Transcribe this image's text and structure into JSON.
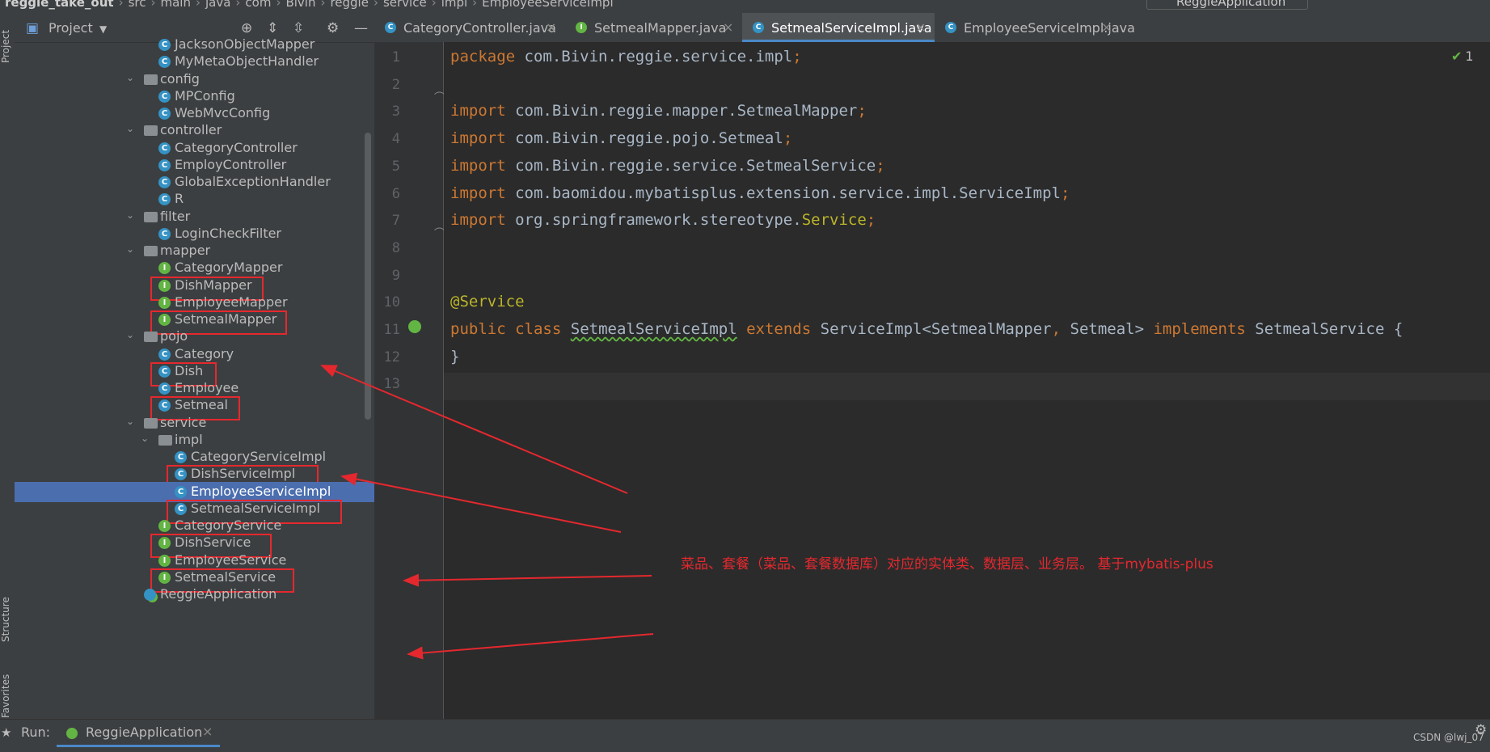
{
  "breadcrumb": {
    "items": [
      "reggie_take_out",
      "src",
      "main",
      "java",
      "com",
      "Bivin",
      "reggie",
      "service",
      "impl",
      "EmployeeServiceImpl"
    ],
    "run_config": "ReggieApplication"
  },
  "left_strip": {
    "tabs": [
      "Project",
      "Structure",
      "Favorites"
    ]
  },
  "project_panel": {
    "title": "Project",
    "tree": [
      {
        "label": "JacksonObjectMapper",
        "kind": "class",
        "level": 2
      },
      {
        "label": "MyMetaObjectHandler",
        "kind": "class",
        "level": 2
      },
      {
        "label": "config",
        "kind": "folder",
        "level": 1,
        "expanded": true
      },
      {
        "label": "MPConfig",
        "kind": "class",
        "level": 2
      },
      {
        "label": "WebMvcConfig",
        "kind": "class",
        "level": 2
      },
      {
        "label": "controller",
        "kind": "folder",
        "level": 1,
        "expanded": true
      },
      {
        "label": "CategoryController",
        "kind": "class",
        "level": 2
      },
      {
        "label": "EmployController",
        "kind": "class",
        "level": 2
      },
      {
        "label": "GlobalExceptionHandler",
        "kind": "class",
        "level": 2
      },
      {
        "label": "R",
        "kind": "class",
        "level": 2
      },
      {
        "label": "filter",
        "kind": "folder",
        "level": 1,
        "expanded": true
      },
      {
        "label": "LoginCheckFilter",
        "kind": "class",
        "level": 2
      },
      {
        "label": "mapper",
        "kind": "folder",
        "level": 1,
        "expanded": true
      },
      {
        "label": "CategoryMapper",
        "kind": "interface",
        "level": 2
      },
      {
        "label": "DishMapper",
        "kind": "interface",
        "level": 2,
        "highlighted": true
      },
      {
        "label": "EmployeeMapper",
        "kind": "interface",
        "level": 2
      },
      {
        "label": "SetmealMapper",
        "kind": "interface",
        "level": 2,
        "highlighted": true
      },
      {
        "label": "pojo",
        "kind": "folder",
        "level": 1,
        "expanded": true
      },
      {
        "label": "Category",
        "kind": "class",
        "level": 2
      },
      {
        "label": "Dish",
        "kind": "class",
        "level": 2,
        "highlighted": true
      },
      {
        "label": "Employee",
        "kind": "class",
        "level": 2
      },
      {
        "label": "Setmeal",
        "kind": "class",
        "level": 2,
        "highlighted": true
      },
      {
        "label": "service",
        "kind": "folder",
        "level": 1,
        "expanded": true
      },
      {
        "label": "impl",
        "kind": "folder",
        "level": 2,
        "expanded": true
      },
      {
        "label": "CategoryServiceImpl",
        "kind": "class",
        "level": 3
      },
      {
        "label": "DishServiceImpl",
        "kind": "class",
        "level": 3,
        "highlighted": true
      },
      {
        "label": "EmployeeServiceImpl",
        "kind": "class",
        "level": 3,
        "selected": true
      },
      {
        "label": "SetmealServiceImpl",
        "kind": "class",
        "level": 3,
        "highlighted": true
      },
      {
        "label": "CategoryService",
        "kind": "interface",
        "level": 2
      },
      {
        "label": "DishService",
        "kind": "interface",
        "level": 2,
        "highlighted": true
      },
      {
        "label": "EmployeeService",
        "kind": "interface",
        "level": 2
      },
      {
        "label": "SetmealService",
        "kind": "interface",
        "level": 2,
        "highlighted": true
      },
      {
        "label": "ReggieApplication",
        "kind": "app",
        "level": 1
      }
    ]
  },
  "editor_tabs": [
    {
      "label": "CategoryController.java",
      "kind": "class",
      "active": false
    },
    {
      "label": "SetmealMapper.java",
      "kind": "interface",
      "active": false
    },
    {
      "label": "SetmealServiceImpl.java",
      "kind": "class",
      "active": true
    },
    {
      "label": "EmployeeServiceImpl.java",
      "kind": "class",
      "active": false
    }
  ],
  "editor": {
    "inspection_count": "1",
    "lines": [
      [
        {
          "t": "package",
          "c": "kw"
        },
        {
          "t": " com.Bivin.reggie.service.impl"
        },
        {
          "t": ";",
          "c": "kw"
        }
      ],
      [],
      [
        {
          "t": "import",
          "c": "kw"
        },
        {
          "t": " com.Bivin.reggie.mapper.SetmealMapper"
        },
        {
          "t": ";",
          "c": "kw"
        }
      ],
      [
        {
          "t": "import",
          "c": "kw"
        },
        {
          "t": " com.Bivin.reggie.pojo.Setmeal"
        },
        {
          "t": ";",
          "c": "kw"
        }
      ],
      [
        {
          "t": "import",
          "c": "kw"
        },
        {
          "t": " com.Bivin.reggie.service.SetmealService"
        },
        {
          "t": ";",
          "c": "kw"
        }
      ],
      [
        {
          "t": "import",
          "c": "kw"
        },
        {
          "t": " com.baomidou.mybatisplus.extension.service.impl.ServiceImpl"
        },
        {
          "t": ";",
          "c": "kw"
        }
      ],
      [
        {
          "t": "import",
          "c": "kw"
        },
        {
          "t": " org.springframework.stereotype."
        },
        {
          "t": "Service",
          "c": "an"
        },
        {
          "t": ";",
          "c": "kw"
        }
      ],
      [],
      [],
      [
        {
          "t": "@Service",
          "c": "an"
        }
      ],
      [
        {
          "t": "public",
          "c": "kw"
        },
        {
          "t": " "
        },
        {
          "t": "class",
          "c": "kw"
        },
        {
          "t": " "
        },
        {
          "t": "SetmealServiceImpl",
          "c": "cls-under"
        },
        {
          "t": " "
        },
        {
          "t": "extends",
          "c": "kw"
        },
        {
          "t": " ServiceImpl<SetmealMapper"
        },
        {
          "t": ",",
          "c": "kw"
        },
        {
          "t": " Setmeal> "
        },
        {
          "t": "implements",
          "c": "kw"
        },
        {
          "t": " SetmealService {"
        }
      ],
      [
        {
          "t": "}"
        }
      ],
      []
    ]
  },
  "annotation": {
    "note": "菜品、套餐（菜品、套餐数据库）对应的实体类、数据层、业务层。 基于mybatis-plus",
    "color": "#e5282e"
  },
  "run_bar": {
    "label": "Run:",
    "tab_label": "ReggieApplication",
    "watermark": "CSDN @lwj_07"
  },
  "colors": {
    "accent": "#4a88c7",
    "selection": "#4b6eaf",
    "class_icon": "#3592c4",
    "interface_icon": "#62b543",
    "keyword": "#cc7832",
    "annotation": "#bbb529",
    "highlight_box": "#e5282e"
  }
}
